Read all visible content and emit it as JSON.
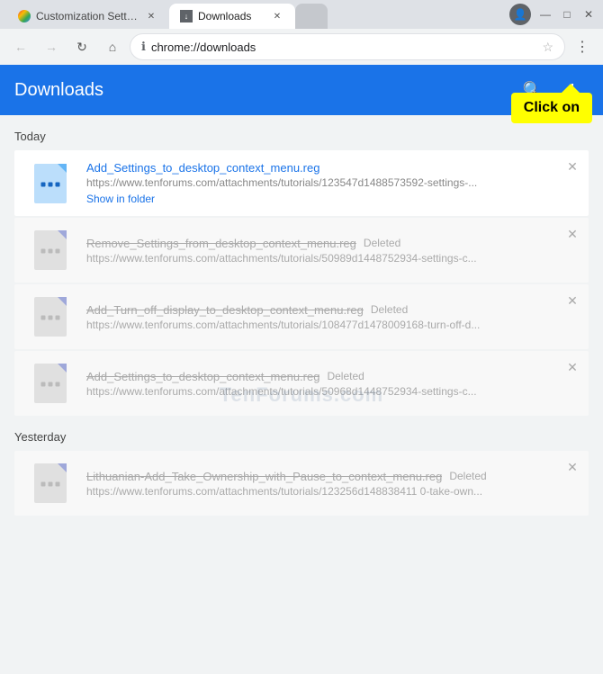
{
  "titleBar": {
    "tabs": [
      {
        "id": "customization",
        "label": "Customization Settings",
        "active": false,
        "hasIcon": true
      },
      {
        "id": "downloads",
        "label": "Downloads",
        "active": true,
        "hasIcon": true
      }
    ],
    "controls": {
      "minimize": "—",
      "restore": "□",
      "close": "✕"
    }
  },
  "navBar": {
    "url": "chrome://downloads",
    "backDisabled": true,
    "forwardDisabled": true,
    "moreLabel": "⋮"
  },
  "header": {
    "title": "Downloads",
    "searchLabel": "🔍",
    "moreLabel": "⋮"
  },
  "callout": {
    "text": "Click on"
  },
  "sections": [
    {
      "id": "today",
      "label": "Today",
      "items": [
        {
          "id": "item1",
          "name": "Add_Settings_to_desktop_context_menu.reg",
          "url": "https://www.tenforums.com/attachments/tutorials/123547d1488573592-settings-...",
          "action": "Show in folder",
          "deleted": false,
          "active": true
        },
        {
          "id": "item2",
          "name": "Remove_Settings_from_desktop_context_menu.reg",
          "url": "https://www.tenforums.com/attachments/tutorials/50989d1448752934-settings-c...",
          "action": null,
          "deleted": true
        },
        {
          "id": "item3",
          "name": "Add_Turn_off_display_to_desktop_context_menu.reg",
          "url": "https://www.tenforums.com/attachments/tutorials/108477d1478009168-turn-off-d...",
          "action": null,
          "deleted": true
        },
        {
          "id": "item4",
          "name": "Add_Settings_to_desktop_context_menu.reg",
          "url": "https://www.tenforums.com/attachments/tutorials/50968d1448752934-settings-c...",
          "action": null,
          "deleted": true
        }
      ]
    },
    {
      "id": "yesterday",
      "label": "Yesterday",
      "items": [
        {
          "id": "item5",
          "name": "Lithuanian-Add_Take_Ownership_with_Pause_to_context_menu.reg",
          "url": "https://www.tenforums.com/attachments/tutorials/123256d148838411 0-take-own...",
          "action": null,
          "deleted": true
        }
      ]
    }
  ],
  "watermark": "TenForums.com",
  "deletedLabel": "Deleted"
}
